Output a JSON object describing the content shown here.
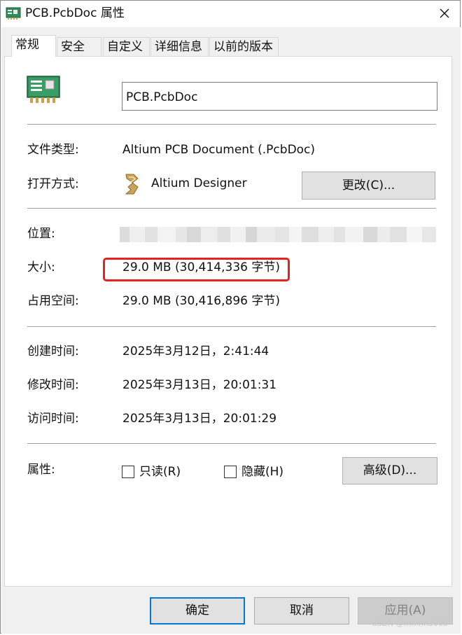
{
  "window": {
    "title": "PCB.PcbDoc 属性",
    "close_label": "关闭"
  },
  "tabs": [
    {
      "label": "常规",
      "active": true
    },
    {
      "label": "安全",
      "active": false
    },
    {
      "label": "自定义",
      "active": false
    },
    {
      "label": "详细信息",
      "active": false
    },
    {
      "label": "以前的版本",
      "active": false
    }
  ],
  "general": {
    "file_name": "PCB.PcbDoc",
    "file_type_label": "文件类型:",
    "file_type_value": "Altium PCB Document (.PcbDoc)",
    "opens_with_label": "打开方式:",
    "opens_with_value": "Altium Designer",
    "change_button": "更改(C)...",
    "location_label": "位置:",
    "size_label": "大小:",
    "size_value": "29.0 MB (30,414,336 字节)",
    "size_on_disk_label": "占用空间:",
    "size_on_disk_value": "29.0 MB (30,416,896 字节)",
    "created_label": "创建时间:",
    "created_value": "2025年3月12日，2:41:44",
    "modified_label": "修改时间:",
    "modified_value": "2025年3月13日，20:01:31",
    "accessed_label": "访问时间:",
    "accessed_value": "2025年3月13日，20:01:29",
    "attributes_label": "属性:",
    "readonly_label": "只读(R)",
    "readonly_checked": false,
    "hidden_label": "隐藏(H)",
    "hidden_checked": false,
    "advanced_button": "高级(D)..."
  },
  "footer": {
    "ok": "确定",
    "cancel": "取消",
    "apply": "应用(A)"
  },
  "watermark": "CSDN @mmhh3000",
  "colors": {
    "highlight": "#e3231f",
    "default_button_border": "#0078d7",
    "pcb_green": "#2e8b57"
  }
}
